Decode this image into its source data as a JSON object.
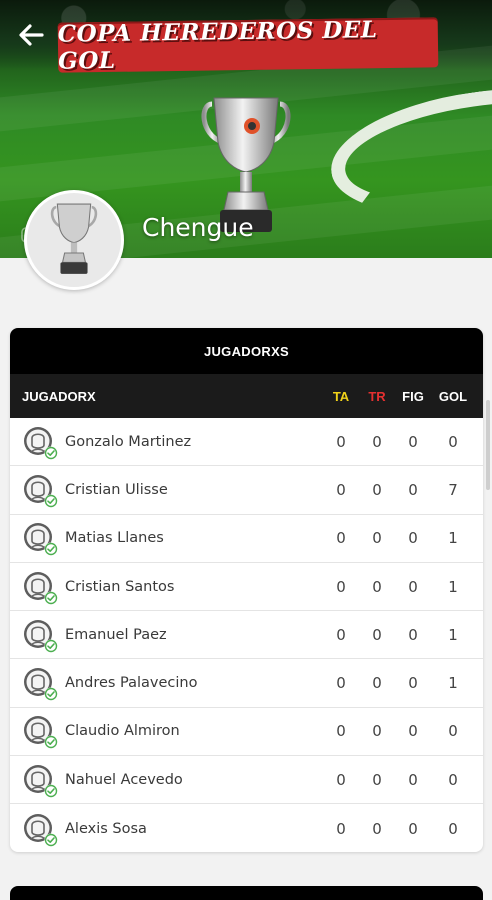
{
  "header": {
    "title": "COPA HEREDEROS DEL GOL",
    "team_name": "Chengue"
  },
  "table": {
    "title": "JUGADORXS",
    "columns": {
      "player": "JUGADORX",
      "ta": "TA",
      "tr": "TR",
      "fig": "FIG",
      "gol": "GOL"
    },
    "rows": [
      {
        "name": "Gonzalo Martinez",
        "ta": "0",
        "tr": "0",
        "fig": "0",
        "gol": "0"
      },
      {
        "name": "Cristian Ulisse",
        "ta": "0",
        "tr": "0",
        "fig": "0",
        "gol": "7"
      },
      {
        "name": "Matias Llanes",
        "ta": "0",
        "tr": "0",
        "fig": "0",
        "gol": "1"
      },
      {
        "name": "Cristian Santos",
        "ta": "0",
        "tr": "0",
        "fig": "0",
        "gol": "1"
      },
      {
        "name": "Emanuel Paez",
        "ta": "0",
        "tr": "0",
        "fig": "0",
        "gol": "1"
      },
      {
        "name": "Andres Palavecino",
        "ta": "0",
        "tr": "0",
        "fig": "0",
        "gol": "1"
      },
      {
        "name": "Claudio Almiron",
        "ta": "0",
        "tr": "0",
        "fig": "0",
        "gol": "0"
      },
      {
        "name": "Nahuel Acevedo",
        "ta": "0",
        "tr": "0",
        "fig": "0",
        "gol": "0"
      },
      {
        "name": "Alexis Sosa",
        "ta": "0",
        "tr": "0",
        "fig": "0",
        "gol": "0"
      }
    ]
  },
  "colors": {
    "banner": "#c72a2a",
    "header_bg": "#000000",
    "ta": "#f0d21a",
    "tr": "#e53030",
    "verified": "#4caf50"
  },
  "icons": {
    "back": "arrow-left-icon",
    "trophy": "trophy-icon",
    "player": "player-avatar-icon",
    "verified": "check-badge-icon"
  }
}
